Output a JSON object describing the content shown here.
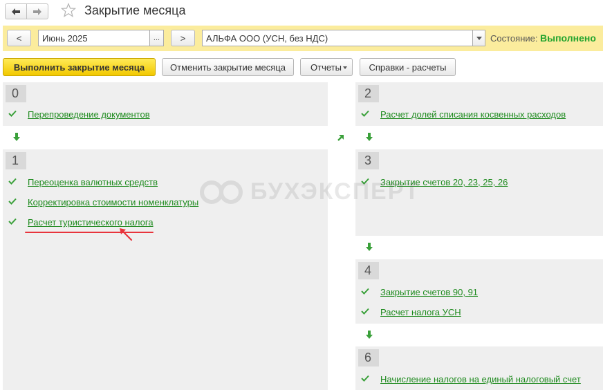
{
  "header": {
    "title": "Закрытие месяца"
  },
  "toolbar": {
    "prev_label": "<",
    "period": "Июнь 2025",
    "period_select_label": "...",
    "next_label": ">",
    "organization": "АЛЬФА ООО (УСН, без НДС)",
    "state_label": "Состояние:",
    "state_value": "Выполнено",
    "state_color": "#22a32e"
  },
  "actions": {
    "run_label": "Выполнить закрытие месяца",
    "cancel_label": "Отменить закрытие месяца",
    "reports_label": "Отчеты",
    "help_label": "Справки - расчеты"
  },
  "steps": [
    {
      "number": "0",
      "tasks": [
        "Перепроведение документов"
      ]
    },
    {
      "number": "1",
      "tasks": [
        "Переоценка валютных средств",
        "Корректировка стоимости номенклатуры",
        "Расчет туристического налога"
      ]
    },
    {
      "number": "2",
      "tasks": [
        "Расчет долей списания косвенных расходов"
      ]
    },
    {
      "number": "3",
      "tasks": [
        "Закрытие счетов 20, 23, 25, 26"
      ]
    },
    {
      "number": "4",
      "tasks": [
        "Закрытие счетов 90, 91",
        "Расчет налога УСН"
      ]
    },
    {
      "number": "6",
      "tasks": [
        "Начисление налогов на единый налоговый счет"
      ]
    }
  ],
  "watermark": "БУХЭКСПЕРТ",
  "colors": {
    "link": "#1d8a1d",
    "check": "#3aa03a",
    "highlight_underline": "#e8343c",
    "toolbar_bg": "#fbec9d",
    "primary_button": "#f2c800"
  }
}
